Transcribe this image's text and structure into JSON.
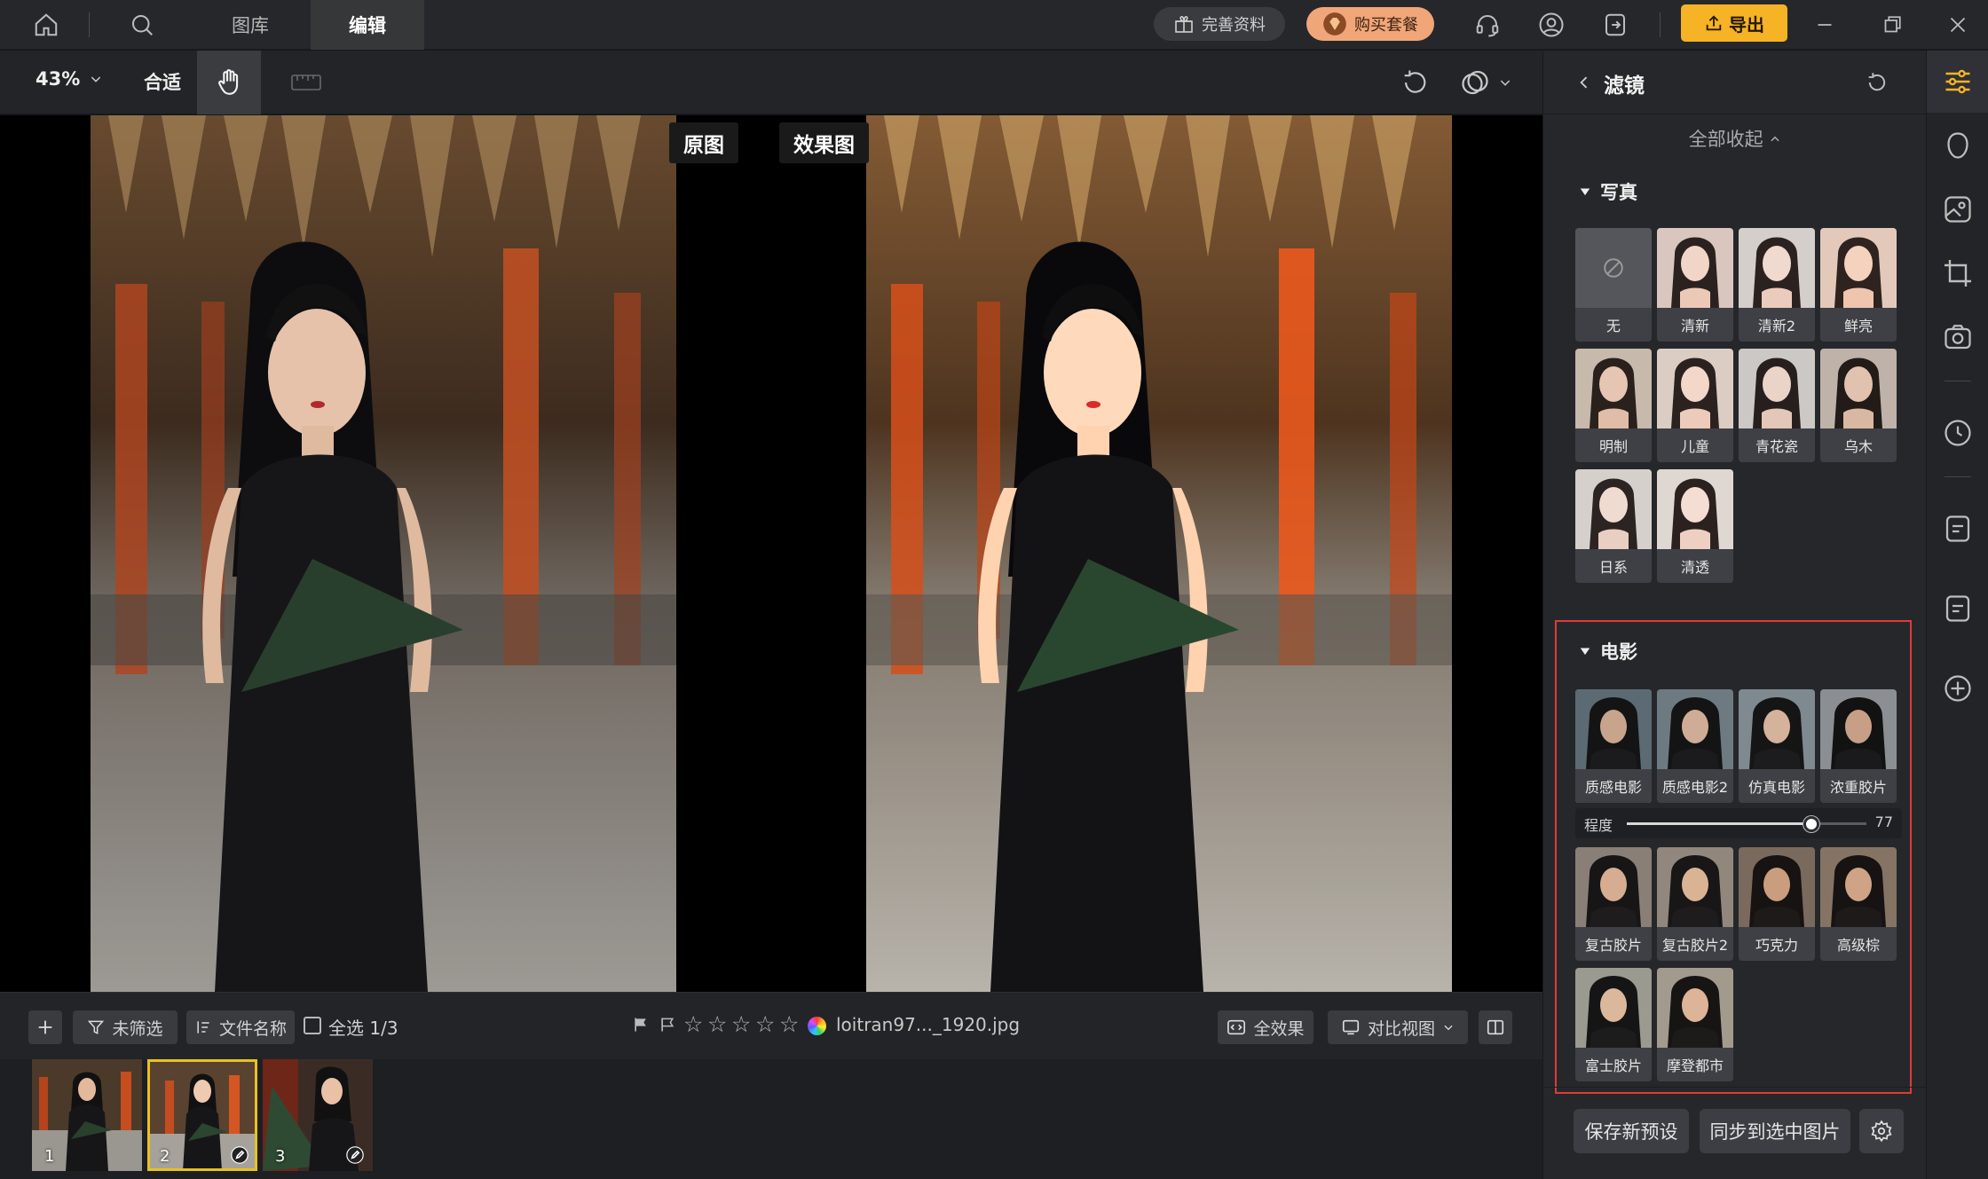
{
  "topbar": {
    "tabs": [
      {
        "label": "图库"
      },
      {
        "label": "编辑"
      }
    ],
    "complete_info_label": "完善资料",
    "buy_package_label": "购买套餐",
    "export_label": "导出"
  },
  "toolbar": {
    "zoom_value": "43%",
    "fit_label": "合适"
  },
  "canvas": {
    "before_label": "原图",
    "after_label": "效果图"
  },
  "bottombar": {
    "unfiltered_label": "未筛选",
    "filename_sort_label": "文件名称",
    "select_all_label": "全选 1/3",
    "file_name": "loitran97..._1920.jpg",
    "all_effects_label": "全效果",
    "compare_view_label": "对比视图"
  },
  "filmstrip": {
    "items": [
      {
        "num": "1"
      },
      {
        "num": "2"
      },
      {
        "num": "3"
      }
    ]
  },
  "panel": {
    "title": "滤镜",
    "collapse_all_label": "全部收起",
    "portrait_section": {
      "title": "写真",
      "presets": [
        "无",
        "清新",
        "清新2",
        "鲜亮",
        "明制",
        "儿童",
        "青花瓷",
        "乌木",
        "日系",
        "清透"
      ]
    },
    "movie_section": {
      "title": "电影",
      "presets_row1": [
        "质感电影",
        "质感电影2",
        "仿真电影",
        "浓重胶片"
      ],
      "presets_rest": [
        "复古胶片",
        "复古胶片2",
        "巧克力",
        "高级棕",
        "富士胶片",
        "摩登都市"
      ],
      "intensity_label": "程度",
      "intensity_value": "77",
      "intensity_level": 77
    },
    "save_preset_label": "保存新预设",
    "sync_label": "同步到选中图片"
  },
  "colors": {
    "accent": "#f5b325",
    "highlight_border": "#e03a3a",
    "selected_thumb": "#e8c220"
  }
}
